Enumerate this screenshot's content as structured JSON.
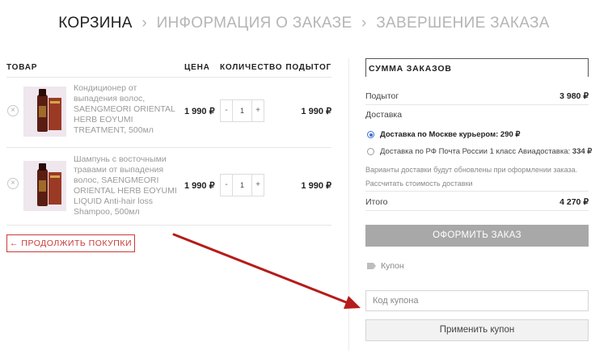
{
  "breadcrumb": {
    "step1": "КОРЗИНА",
    "step2": "ИНФОРМАЦИЯ О ЗАКАЗЕ",
    "step3": "ЗАВЕРШЕНИЕ ЗАКАЗА",
    "separator": "›"
  },
  "cart": {
    "headers": {
      "product": "ТОВАР",
      "price": "ЦЕНА",
      "quantity": "КОЛИЧЕСТВО",
      "subtotal": "ПОДЫТОГ"
    },
    "items": [
      {
        "name": "Кондиционер от выпадения волос, SAENGMEORI ORIENTAL HERB EOYUMI TREATMENT, 500мл",
        "price": "1 990 ₽",
        "qty": "1",
        "subtotal": "1 990 ₽"
      },
      {
        "name": "Шампунь с восточными травами от выпадения волос, SAENGMEORI ORIENTAL HERB EOYUMI LIQUID Anti-hair loss Shampoo, 500мл",
        "price": "1 990 ₽",
        "qty": "1",
        "subtotal": "1 990 ₽"
      }
    ],
    "remove_glyph": "×",
    "minus": "-",
    "plus": "+",
    "continue_label": "← ПРОДОЛЖИТЬ ПОКУПКИ"
  },
  "totals": {
    "title": "СУММА ЗАКАЗОВ",
    "subtotal_label": "Подытог",
    "subtotal_value": "3 980 ₽",
    "delivery_label": "Доставка",
    "shipping": [
      {
        "label": "Доставка по Москве курьером:",
        "price": "290 ₽",
        "selected": true
      },
      {
        "label": "Доставка по РФ Почта России 1 класс Авиадоставка:",
        "price": "334 ₽",
        "selected": false
      }
    ],
    "note": "Варианты доставки будут обновлены при оформлении заказа.",
    "calc_link": "Рассчитать стоимость доставки",
    "total_label": "Итого",
    "total_value": "4 270 ₽",
    "checkout_label": "ОФОРМИТЬ ЗАКАЗ"
  },
  "coupon": {
    "label": "Купон",
    "placeholder": "Код купона",
    "apply_label": "Применить купон"
  },
  "colors": {
    "accent_red": "#c93a3a",
    "radio_blue": "#3b6fd8",
    "checkout_bg": "#a8a8a8",
    "annotation_arrow": "#b51c1c"
  },
  "icons": {
    "coupon": "tag-icon",
    "remove": "close-circle-icon"
  }
}
